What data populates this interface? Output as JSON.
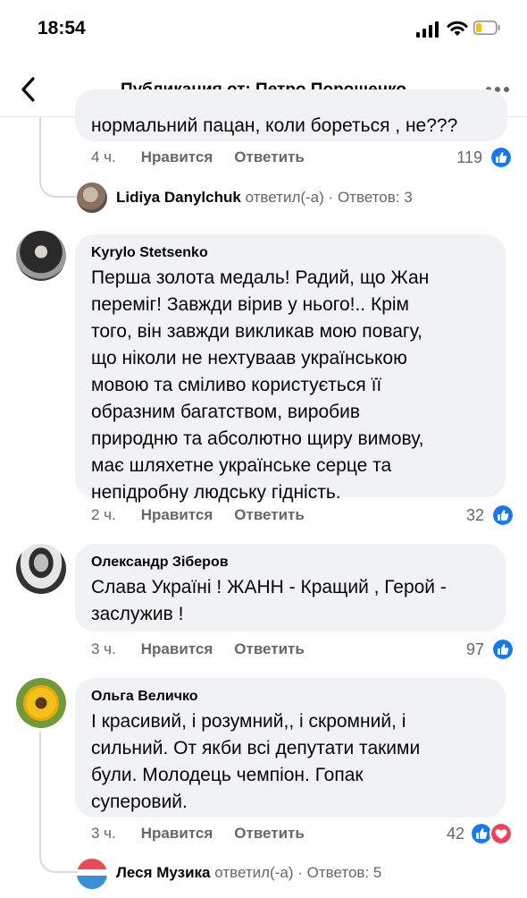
{
  "status_bar": {
    "time": "18:54"
  },
  "header": {
    "title": "Публикация от: Петро Порошенко"
  },
  "comments": [
    {
      "text_lines": [
        "нормальний пацан, коли бореться , не???"
      ],
      "time": "4 ч.",
      "like_label": "Нравится",
      "reply_label": "Ответить",
      "reactions_count": "119",
      "reactions": [
        "like"
      ],
      "reply_preview": {
        "author": "Lidiya Danylchuk",
        "action": "ответил(-а)",
        "sep": "·",
        "replies": "Ответов: 3"
      }
    },
    {
      "author": "Kyrylo Stetsenko",
      "text_lines": [
        "Перша золота медаль! Радий, що Жан",
        "переміг! Завжди вірив у нього!.. Крім",
        "того, він завжди викликав мою повагу,",
        "що ніколи не нехтуваав українською",
        "мовою та сміливо користується її",
        "образним багатством, виробив",
        "природню та абсолютно щиру вимову,",
        "має шляхетне українське серце та",
        "непідробну людську гідність."
      ],
      "time": "2 ч.",
      "like_label": "Нравится",
      "reply_label": "Ответить",
      "reactions_count": "32",
      "reactions": [
        "like"
      ]
    },
    {
      "author": "Олександр Зіберов",
      "text_lines": [
        "Слава  Україні ! ЖАНН - Кращий , Герой -",
        "заслужив !"
      ],
      "time": "3 ч.",
      "like_label": "Нравится",
      "reply_label": "Ответить",
      "reactions_count": "97",
      "reactions": [
        "like"
      ]
    },
    {
      "author": "Ольга Величко",
      "text_lines": [
        "І красивий, і розумний,, і скромний, і",
        "сильний. От якби всі депутати такими",
        "були. Молодець чемпіон. Гопак",
        "суперовий."
      ],
      "time": "3 ч.",
      "like_label": "Нравится",
      "reply_label": "Ответить",
      "reactions_count": "42",
      "reactions": [
        "like",
        "love"
      ],
      "reply_preview": {
        "author": "Леся Музика",
        "action": "ответил(-а)",
        "sep": "·",
        "replies": "Ответов: 5"
      }
    }
  ],
  "colors": {
    "like_blue": "#1877f2",
    "love_red": "#f33e58",
    "meta_grey": "#65676b",
    "bubble_bg": "#f0f2f5"
  },
  "icons": [
    "back-chevron-icon",
    "more-dots-icon",
    "like-reaction-icon",
    "love-reaction-icon",
    "signal-icon",
    "wifi-icon",
    "battery-icon"
  ]
}
